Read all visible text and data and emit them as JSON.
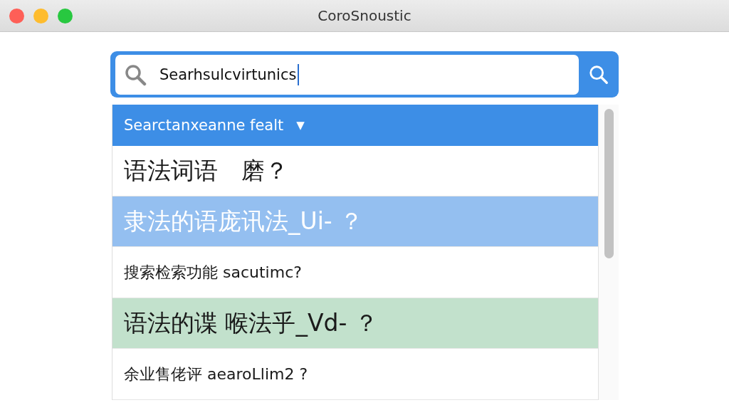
{
  "window": {
    "title": "CoroSnoustic"
  },
  "search": {
    "value": "Searhsulcvirtunics"
  },
  "dropdown": {
    "label": "Searctanxeanne fealt",
    "caret": "▼"
  },
  "results": [
    {
      "text": "语法词语　磨？",
      "kind": "large"
    },
    {
      "text": "隶法的语庞讯法_Ui- ？",
      "kind": "large",
      "color": "#94bff0"
    },
    {
      "text": "搜索检索功能 sacutimc?",
      "kind": "small"
    },
    {
      "text": "语法的谍 喉法乎_Vd- ？",
      "kind": "large",
      "color": "#c2e1cc"
    },
    {
      "text": "余业售佬评 aearoLlim2 ?",
      "kind": "small"
    }
  ]
}
